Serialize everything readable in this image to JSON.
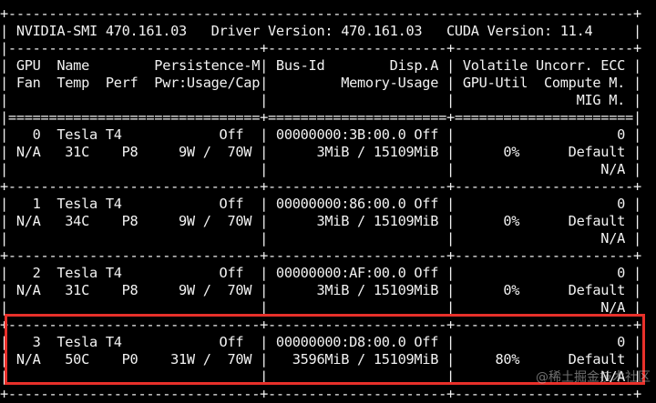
{
  "terminal": {
    "lines": [
      "+-----------------------------------------------------------------------------+",
      "| NVIDIA-SMI 470.161.03   Driver Version: 470.161.03   CUDA Version: 11.4     |",
      "|-------------------------------+----------------------+----------------------+",
      "| GPU  Name        Persistence-M| Bus-Id        Disp.A | Volatile Uncorr. ECC |",
      "| Fan  Temp  Perf  Pwr:Usage/Cap|         Memory-Usage | GPU-Util  Compute M. |",
      "|                               |                      |               MIG M. |",
      "|===============================+======================+======================|",
      "|   0  Tesla T4            Off  | 00000000:3B:00.0 Off |                    0 |",
      "| N/A   31C    P8     9W /  70W |      3MiB / 15109MiB |      0%      Default |",
      "|                               |                      |                  N/A |",
      "+-------------------------------+----------------------+----------------------+",
      "|   1  Tesla T4            Off  | 00000000:86:00.0 Off |                    0 |",
      "| N/A   34C    P8     9W /  70W |      3MiB / 15109MiB |      0%      Default |",
      "|                               |                      |                  N/A |",
      "+-------------------------------+----------------------+----------------------+",
      "|   2  Tesla T4            Off  | 00000000:AF:00.0 Off |                    0 |",
      "| N/A   31C    P8     9W /  70W |      3MiB / 15109MiB |      0%      Default |",
      "|                               |                      |                  N/A |",
      "+-------------------------------+----------------------+----------------------+",
      "|   3  Tesla T4            Off  | 00000000:D8:00.0 Off |                    0 |",
      "| N/A   50C    P0    31W /  70W |   3596MiB / 15109MiB |     80%      Default |",
      "|                               |                      |                  N/A |",
      "+-------------------------------+----------------------+----------------------+"
    ]
  },
  "highlight": {
    "color": "#e8302a",
    "gpu_index": "3"
  },
  "watermark": {
    "text": "@稀土掘金技术社区"
  },
  "colors": {
    "background": "#000000",
    "foreground": "#f2f2f2"
  }
}
